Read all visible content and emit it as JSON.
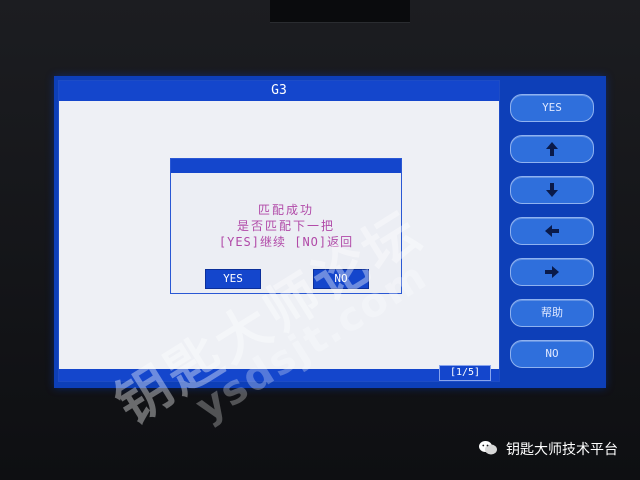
{
  "window": {
    "title": "G3",
    "page_indicator": "[1/5]"
  },
  "dialog": {
    "message_line1": "匹配成功",
    "message_line2": "是否匹配下一把",
    "message_line3": "[YES]继续 [NO]返回",
    "yes_label": "YES",
    "no_label": "NO"
  },
  "side_buttons": {
    "yes_label": "YES",
    "up_icon": "arrow-up-icon",
    "down_icon": "arrow-down-icon",
    "left_icon": "arrow-left-icon",
    "right_icon": "arrow-right-icon",
    "help_label": "帮助",
    "no_label": "NO"
  },
  "watermark": {
    "chinese": "钥匙大师论坛",
    "url": "ysdsjt.com"
  },
  "brand": {
    "label": "钥匙大师技术平台",
    "logo_icon": "wechat-icon"
  },
  "colors": {
    "screen_blue": "#1446cc",
    "dialog_text": "#b14aa8",
    "button_blue": "#2f6fdc"
  }
}
